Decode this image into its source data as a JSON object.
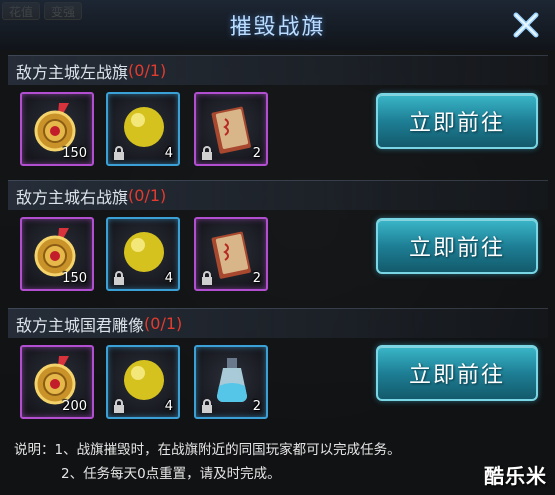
{
  "hud": {
    "chips": [
      "花值",
      "变强"
    ]
  },
  "dialog": {
    "title": "摧毁战旗",
    "close_icon": "close-x-icon"
  },
  "tasks": [
    {
      "name": "敌方主城左战旗",
      "progress": "(0/1)",
      "go_label": "立即前往",
      "rewards": [
        {
          "icon": "golden-medal-icon",
          "rarity": "purple",
          "qty": "150",
          "locked": false
        },
        {
          "icon": "gold-orb-icon",
          "rarity": "blue",
          "qty": "4",
          "locked": true
        },
        {
          "icon": "scroll-talisman-icon",
          "rarity": "purple",
          "qty": "2",
          "locked": true
        }
      ]
    },
    {
      "name": "敌方主城右战旗",
      "progress": "(0/1)",
      "go_label": "立即前往",
      "rewards": [
        {
          "icon": "golden-medal-icon",
          "rarity": "purple",
          "qty": "150",
          "locked": false
        },
        {
          "icon": "gold-orb-icon",
          "rarity": "blue",
          "qty": "4",
          "locked": true
        },
        {
          "icon": "scroll-talisman-icon",
          "rarity": "purple",
          "qty": "2",
          "locked": true
        }
      ]
    },
    {
      "name": "敌方主城国君雕像",
      "progress": "(0/1)",
      "go_label": "立即前往",
      "rewards": [
        {
          "icon": "golden-medal-icon",
          "rarity": "purple",
          "qty": "200",
          "locked": false
        },
        {
          "icon": "gold-orb-icon",
          "rarity": "blue",
          "qty": "4",
          "locked": true
        },
        {
          "icon": "potion-bottle-icon",
          "rarity": "blue",
          "qty": "2",
          "locked": true
        }
      ]
    }
  ],
  "notes": {
    "line1": "说明：1、战旗摧毁时，在战旗附近的同国玩家都可以完成任务。",
    "line2": "2、任务每天0点重置，请及时完成。"
  },
  "watermark": "酷乐米",
  "colors": {
    "progress_red": "#e23b2f",
    "title_blue": "#b9dcff",
    "purple_frame": "#b24fd0",
    "blue_frame": "#3aa0d6",
    "button_teal": "#1e7f95"
  }
}
